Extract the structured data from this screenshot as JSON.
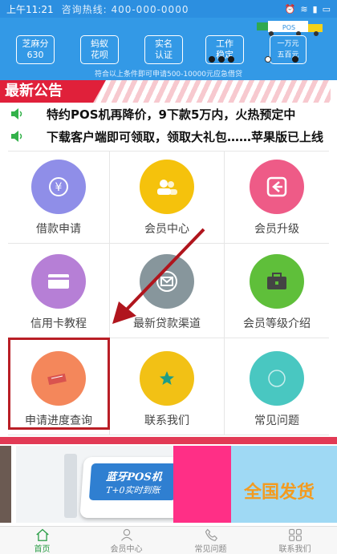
{
  "status_bar": {
    "time": "上午11:21",
    "banner_text": "咨询热线: 400-000-0000"
  },
  "banner": {
    "badges": [
      {
        "line1": "芝麻分",
        "line2": "630"
      },
      {
        "line1": "蚂蚁",
        "line2": "花呗"
      },
      {
        "line1": "实名",
        "line2": "认证"
      },
      {
        "line1": "工作",
        "line2": "稳定"
      },
      {
        "line1": "一万元",
        "line2": "五百元"
      }
    ],
    "note": "符合以上条件即可申请500-10000元应急借贷",
    "truck_label": "POS"
  },
  "notice": {
    "title": "最新公告",
    "items": [
      "特约POS机再降价，9下款5万内，火热预定中",
      "下载客户端即可领取，领取大礼包……苹果版已上线"
    ]
  },
  "grid": {
    "items": [
      {
        "label": "借款申请",
        "icon": "yuan-icon",
        "color": "#8f8ee8"
      },
      {
        "label": "会员中心",
        "icon": "users-icon",
        "color": "#f5c20c"
      },
      {
        "label": "会员升级",
        "icon": "upgrade-icon",
        "color": "#ee5b87"
      },
      {
        "label": "信用卡教程",
        "icon": "card-icon",
        "color": "#b67fd6"
      },
      {
        "label": "最新贷款渠道",
        "icon": "mail-icon",
        "color": "#87969c"
      },
      {
        "label": "会员等级介绍",
        "icon": "briefcase-icon",
        "color": "#5fbf3a"
      },
      {
        "label": "申请进度查询",
        "icon": "search-doc-icon",
        "color": "#f4875b"
      },
      {
        "label": "联系我们",
        "icon": "star-icon",
        "color": "#f2c115"
      },
      {
        "label": "常见问题",
        "icon": "help-icon",
        "color": "#49c7c1"
      }
    ]
  },
  "ad": {
    "device_line1": "蓝牙POS机",
    "device_line2": "T+0实时到账",
    "sky_text": "全国发货"
  },
  "tabbar": {
    "items": [
      {
        "label": "首页",
        "icon": "home-icon",
        "active": true
      },
      {
        "label": "会员中心",
        "icon": "user-icon",
        "active": false
      },
      {
        "label": "常见问题",
        "icon": "phone-icon",
        "active": false
      },
      {
        "label": "联系我们",
        "icon": "grid-icon",
        "active": false
      }
    ]
  },
  "colors": {
    "accent_blue": "#3399e6",
    "notice_red": "#e0203a",
    "highlight_border": "#b91e26",
    "tab_active": "#2a9d46"
  }
}
